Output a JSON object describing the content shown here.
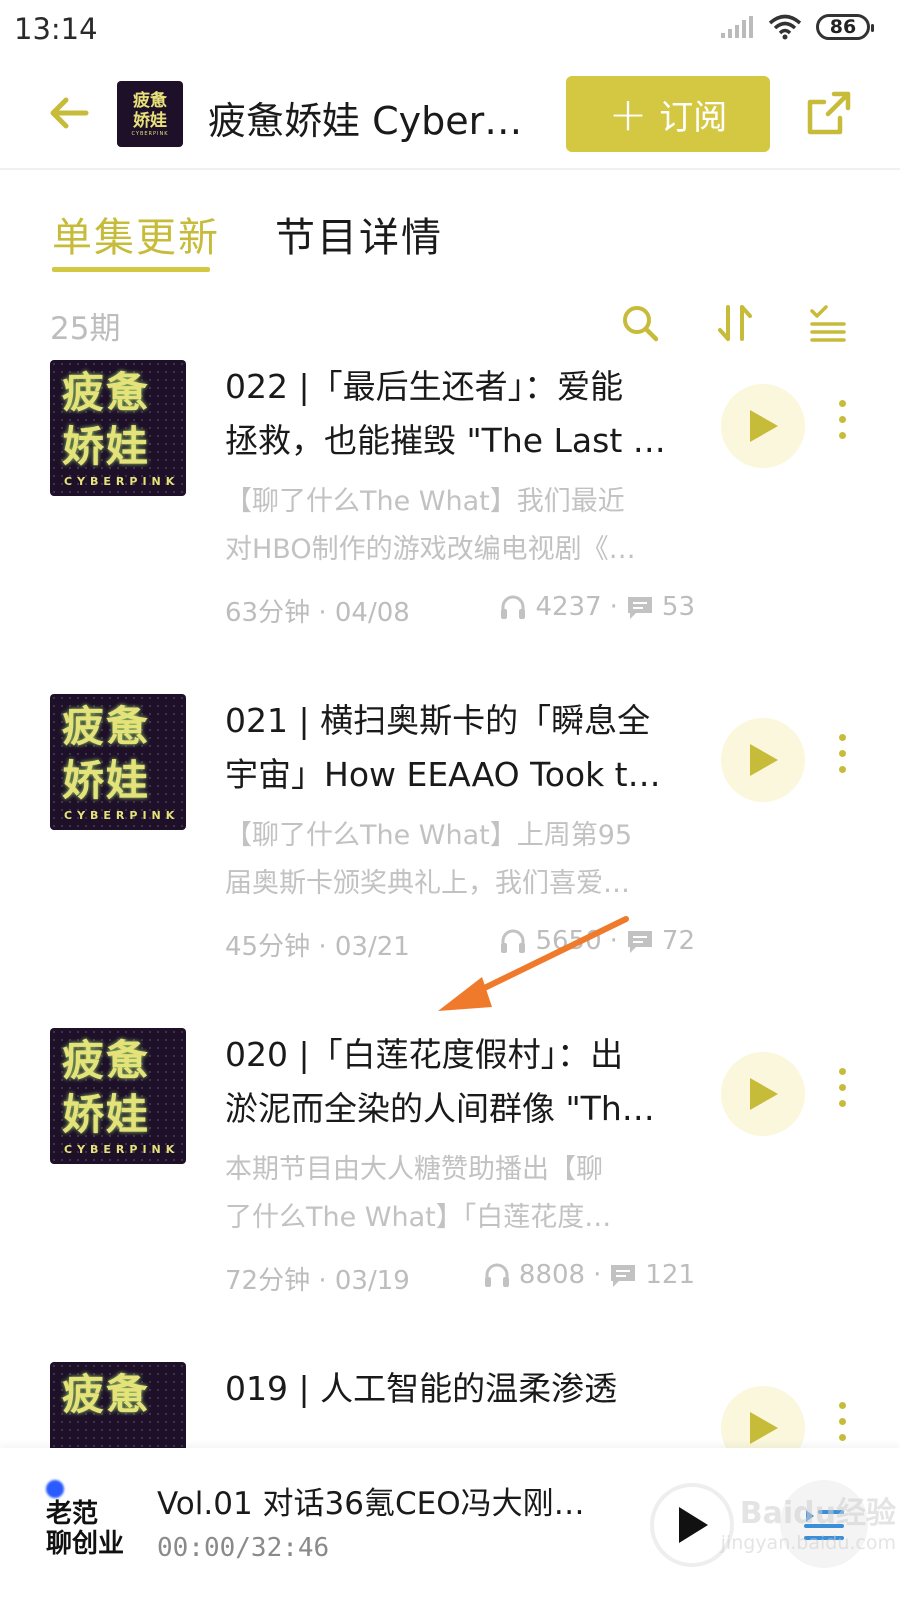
{
  "status_bar": {
    "time": "13:14",
    "battery": "86"
  },
  "header": {
    "cover_text": "疲惫娇娃",
    "cover_sub": "CYBERPINK",
    "title": "疲惫娇娃 CyberPink",
    "subscribe_label": "订阅",
    "accent": "#d4c842"
  },
  "tabs": [
    {
      "label": "单集更新",
      "active": true
    },
    {
      "label": "节目详情",
      "active": false
    }
  ],
  "list": {
    "count_label": "25期"
  },
  "episodes": [
    {
      "cover_text": "疲惫娇娃",
      "cover_sub": "CYBERPINK",
      "title_line1": "022 |「最后生还者」：爱能",
      "title_line2": "拯救，也能摧毁 \"The Last …",
      "desc_line1": "【聊了什么The What】我们最近",
      "desc_line2": "对HBO制作的游戏改编电视剧《…",
      "duration_date": "63分钟 · 04/08",
      "plays": "4237",
      "comments": "53"
    },
    {
      "cover_text": "疲惫娇娃",
      "cover_sub": "CYBERPINK",
      "title_line1": "021 | 横扫奥斯卡的「瞬息全",
      "title_line2": "宇宙」How EEAAO Took t…",
      "desc_line1": "【聊了什么The What】上周第95",
      "desc_line2": "届奥斯卡颁奖典礼上，我们喜爱…",
      "duration_date": "45分钟 · 03/21",
      "plays": "5650",
      "comments": "72"
    },
    {
      "cover_text": "疲惫娇娃",
      "cover_sub": "CYBERPINK",
      "title_line1": "020 |「白莲花度假村」：出",
      "title_line2": "淤泥而全染的人间群像 \"Th…",
      "desc_line1": "本期节目由大人糖赞助播出【聊",
      "desc_line2": "了什么The What】「白莲花度…",
      "duration_date": "72分钟 · 03/19",
      "plays": "8808",
      "comments": "121"
    },
    {
      "cover_text": "疲惫",
      "cover_sub": "",
      "title_line1": "019 | 人工智能的温柔渗透",
      "title_line2": "",
      "desc_line1": "",
      "desc_line2": "",
      "duration_date": "",
      "plays": "",
      "comments": ""
    }
  ],
  "mini_player": {
    "cover_text_line1": "老范",
    "cover_text_line2": "聊创业",
    "title": "Vol.01 对话36氪CEO冯大刚：…",
    "time": "00:00/32:46"
  },
  "watermark": {
    "line1": "Baidu经验",
    "line2": "jingyan.baidu.com"
  },
  "colors": {
    "accent": "#d4c842",
    "tab_active": "#c7bb3a",
    "arrow": "#f07a2b",
    "cover_bg": "#1d1028"
  }
}
